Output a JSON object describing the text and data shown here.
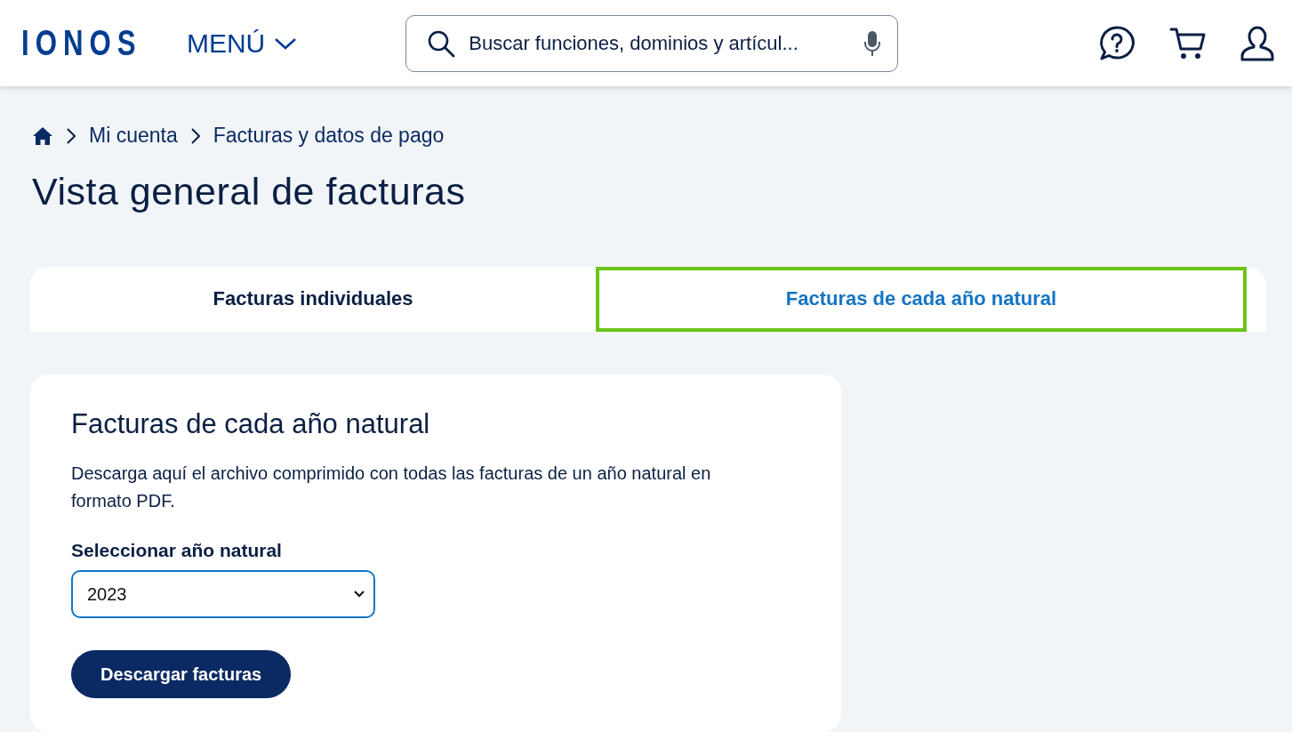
{
  "header": {
    "logo": "IONOS",
    "menu": "MENÚ",
    "search": {
      "placeholder": "Buscar funciones, dominios y artícul..."
    }
  },
  "breadcrumb": [
    "Mi cuenta",
    "Facturas y datos de pago"
  ],
  "page_title": "Vista general de facturas",
  "tabs": [
    {
      "label": "Facturas individuales",
      "selected": false
    },
    {
      "label": "Facturas de cada año natural",
      "selected": true
    }
  ],
  "card": {
    "title": "Facturas de cada año natural",
    "description": "Descarga aquí el archivo comprimido con todas las facturas de un año natural en formato PDF.",
    "select_label": "Seleccionar año natural",
    "select_value": "2023",
    "button": "Descargar facturas"
  }
}
